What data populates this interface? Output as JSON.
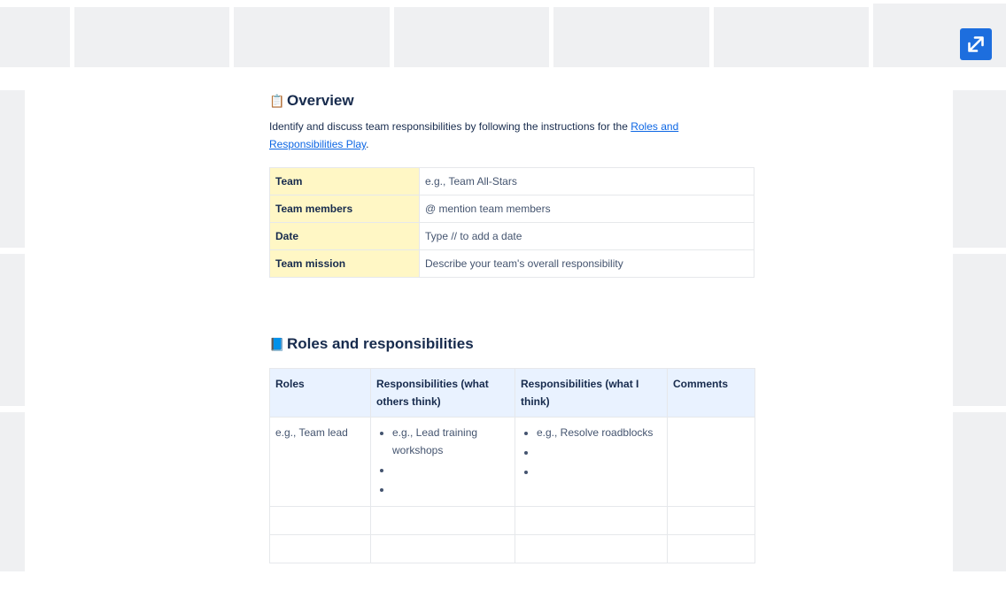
{
  "overview": {
    "icon": "clipboard-emoji",
    "title": "Overview",
    "intro_text": "Identify and discuss team responsibilities by following the instructions for the ",
    "intro_link": "Roles and Responsibilities Play",
    "intro_end": ".",
    "rows": [
      {
        "label": "Team",
        "value": "e.g., Team All-Stars"
      },
      {
        "label": "Team members",
        "value": "@ mention team members"
      },
      {
        "label": "Date",
        "value": "Type // to add a date"
      },
      {
        "label": "Team mission",
        "value": "Describe your team's overall responsibility"
      }
    ]
  },
  "roles": {
    "icon": "blue-book-emoji",
    "title": "Roles and responsibilities",
    "headers": [
      "Roles",
      "Responsibilities (what others think)",
      "Responsibilities (what I think)",
      "Comments"
    ],
    "row1": {
      "role": "e.g., Team lead",
      "others_think": [
        "e.g., Lead training workshops",
        "",
        ""
      ],
      "i_think": [
        "e.g., Resolve roadblocks",
        "",
        ""
      ],
      "comments": ""
    }
  },
  "colors": {
    "accent": "#1d6ede",
    "link": "#0c66e4",
    "label_bg": "#fff7c5",
    "header_bg": "#e9f2ff"
  }
}
